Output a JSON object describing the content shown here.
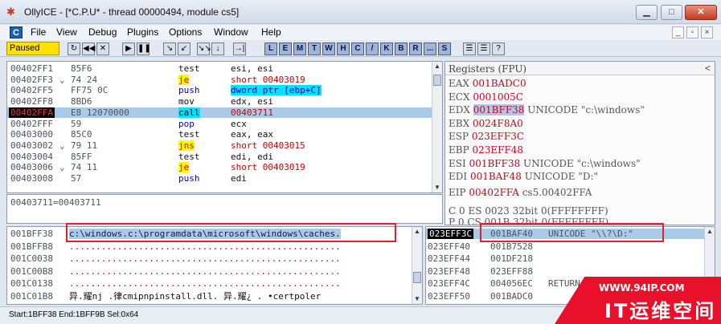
{
  "window": {
    "title": "OllyICE - [*C.P.U* - thread 00000494, module cs5]",
    "min_glyph": "▁",
    "max_glyph": "□",
    "close_glyph": "✕"
  },
  "menu": {
    "items": [
      "File",
      "View",
      "Debug",
      "Plugins",
      "Options",
      "Window",
      "Help"
    ],
    "app_icon": "C",
    "mdi": [
      "_",
      "▫",
      "×"
    ]
  },
  "toolbar": {
    "status": "Paused",
    "buttons": [
      "↻",
      "◀◀",
      "✕",
      "▶",
      "❚❚",
      "↘",
      "↙",
      "↘↘",
      "↓",
      "→|"
    ],
    "letters": [
      "L",
      "E",
      "M",
      "T",
      "W",
      "H",
      "C",
      "/",
      "K",
      "B",
      "R",
      "...",
      "S"
    ],
    "extra": [
      "☰",
      "☰",
      "?"
    ]
  },
  "disasm": {
    "rows": [
      {
        "addr": "00402FF1",
        "mark": "",
        "hex": "85F6",
        "mn": "test",
        "op": "esi, esi"
      },
      {
        "addr": "00402FF3",
        "mark": "⌄",
        "hex": "74 24",
        "mn": "je",
        "op": "short 00403019"
      },
      {
        "addr": "00402FF5",
        "mark": "",
        "hex": "FF75 0C",
        "mn": "push",
        "op": "dword ptr [ebp+C]"
      },
      {
        "addr": "00402FF8",
        "mark": "",
        "hex": "8BD6",
        "mn": "mov",
        "op": "edx, esi"
      },
      {
        "addr": "00402FFA",
        "mark": "",
        "hex": "E8 12070000",
        "mn": "call",
        "op": "00403711"
      },
      {
        "addr": "00402FFF",
        "mark": "",
        "hex": "59",
        "mn": "pop",
        "op": "ecx"
      },
      {
        "addr": "00403000",
        "mark": "",
        "hex": "85C0",
        "mn": "test",
        "op": "eax, eax"
      },
      {
        "addr": "00403002",
        "mark": "⌄",
        "hex": "79 11",
        "mn": "jns",
        "op": "short 00403015"
      },
      {
        "addr": "00403004",
        "mark": "",
        "hex": "85FF",
        "mn": "test",
        "op": "edi, edi"
      },
      {
        "addr": "00403006",
        "mark": "⌄",
        "hex": "74 11",
        "mn": "je",
        "op": "short 00403019"
      },
      {
        "addr": "00403008",
        "mark": "",
        "hex": "57",
        "mn": "push",
        "op": "edi"
      }
    ],
    "info": "00403711=00403711"
  },
  "registers": {
    "header": "Registers (FPU)",
    "collapse_glyph": "<",
    "lines": [
      {
        "name": "EAX",
        "val": "001BADC0",
        "note": ""
      },
      {
        "name": "ECX",
        "val": "0001005C",
        "note": ""
      },
      {
        "name": "EDX",
        "val": "001BFF38",
        "note": "UNICODE \"c:\\windows\""
      },
      {
        "name": "EBX",
        "val": "0024F8A0",
        "note": ""
      },
      {
        "name": "ESP",
        "val": "023EFF3C",
        "note": ""
      },
      {
        "name": "EBP",
        "val": "023EFF48",
        "note": ""
      },
      {
        "name": "ESI",
        "val": "001BFF38",
        "note": "UNICODE \"c:\\windows\""
      },
      {
        "name": "EDI",
        "val": "001BAF48",
        "note": "UNICODE \"D:\""
      }
    ],
    "eip": {
      "name": "EIP",
      "val": "00402FFA",
      "note": "cs5.00402FFA"
    },
    "flags": [
      "C 0  ES 0023 32bit 0(FFFFFFFF)",
      "P 0  CS 001B 32bit 0(FFFFFFFF)"
    ]
  },
  "dump": {
    "rows": [
      {
        "addr": "001BFF38",
        "text": "c:\\windows.c:\\programdata\\microsoft\\windows\\caches."
      },
      {
        "addr": "001BFFB8",
        "text": "..................................................."
      },
      {
        "addr": "001C0038",
        "text": "..................................................."
      },
      {
        "addr": "001C00B8",
        "text": "..................................................."
      },
      {
        "addr": "001C0138",
        "text": "..................................................."
      },
      {
        "addr": "001C01B8",
        "text": " 异.耀nj .律cmipnpinstall.dll.  异.耀¿  . •certpoler"
      }
    ]
  },
  "stack": {
    "rows": [
      {
        "addr": "023EFF3C",
        "val": "001BAF40",
        "note": "UNICODE \"\\\\?\\D:\""
      },
      {
        "addr": "023EFF40",
        "val": "001B7528",
        "note": ""
      },
      {
        "addr": "023EFF44",
        "val": "001DF218",
        "note": ""
      },
      {
        "addr": "023EFF48",
        "val": "023EFF88",
        "note": ""
      },
      {
        "addr": "023EFF4C",
        "val": "004056EC",
        "note": "RETURN to"
      },
      {
        "addr": "023EFF50",
        "val": "001BADC0",
        "note": ""
      }
    ]
  },
  "status": "Start:1BFF38 End:1BFF9B Sel:0x64",
  "watermark": {
    "url": "WWW.94IP.COM",
    "name": "IT运维空间"
  },
  "colors": {
    "accent_red": "#e0232a",
    "selection_blue": "#a9cbe9",
    "highlight_yellow": "#ffff00",
    "highlight_cyan": "#00e5ff"
  }
}
